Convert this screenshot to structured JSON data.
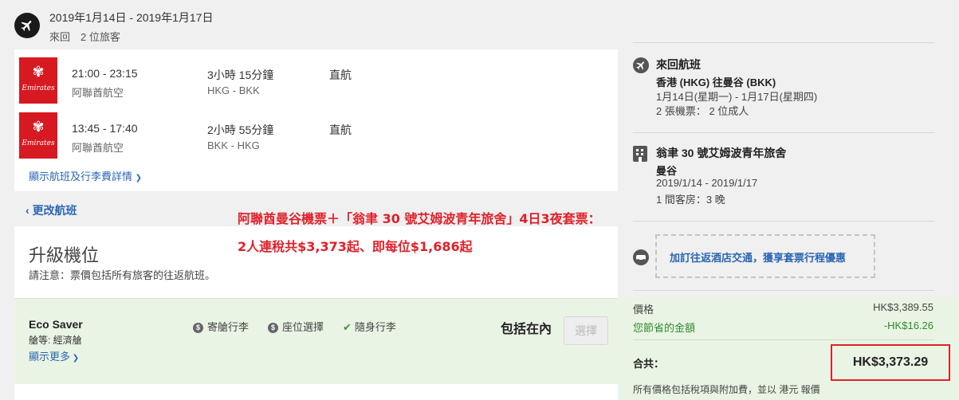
{
  "header": {
    "dates": "2019年1月14日 - 2019年1月17日",
    "trip_info": "來回　2 位旅客"
  },
  "flights": [
    {
      "airline_logo": "Emirates",
      "time": "21:00 - 23:15",
      "airline": "阿聯酋航空",
      "duration": "3小時 15分鐘",
      "route": "HKG - BKK",
      "stops": "直航"
    },
    {
      "airline_logo": "Emirates",
      "time": "13:45 - 17:40",
      "airline": "阿聯酋航空",
      "duration": "2小時 55分鐘",
      "route": "BKK - HKG",
      "stops": "直航"
    }
  ],
  "show_details": "顯示航班及行李費詳情",
  "change_flight": "更改航班",
  "upgrade": {
    "title": "升級機位",
    "note": "請注意：票價包括所有旅客的往返航班。"
  },
  "fare": {
    "name": "Eco Saver",
    "cabin": "艙等: 經濟艙",
    "show_more": "顯示更多",
    "features": [
      "寄艙行李",
      "座位選擇",
      "隨身行李"
    ],
    "included": "包括在內",
    "select_label": "選擇"
  },
  "overlay": {
    "line1": "阿聯酋曼谷機票＋「翁聿 30 號艾姆波青年旅舍」4日3夜套票：",
    "line2": "2人連稅共$3,373起、即每位$1,686起"
  },
  "sidebar": {
    "flight": {
      "title": "來回航班",
      "route": "香港 (HKG) 往曼谷 (BKK)",
      "dates": "1月14日(星期一) - 1月17日(星期四)",
      "tickets": "2 張機票： 2 位成人"
    },
    "hotel": {
      "name": "翁聿 30 號艾姆波青年旅舍",
      "city": "曼谷",
      "dates": "2019/1/14 - 2019/1/17",
      "rooms": "1 間客房：3 晚"
    },
    "transfer": "加訂往返酒店交通，獲享套票行程優惠",
    "price_label": "價格",
    "price_value": "HK$3,389.55",
    "saving_label": "您節省的金額",
    "saving_value": "-HK$16.26",
    "total_label": "合共：",
    "total_value": "HK$3,373.29",
    "footnote": "所有價格包括稅項與附加費，並以 港元 報價"
  },
  "colors": {
    "link": "#2a66b3",
    "emirates_red": "#d71921",
    "highlight_red": "#e0202a",
    "fare_bg": "#eaf4e4",
    "saving_green": "#2f8a2f"
  }
}
